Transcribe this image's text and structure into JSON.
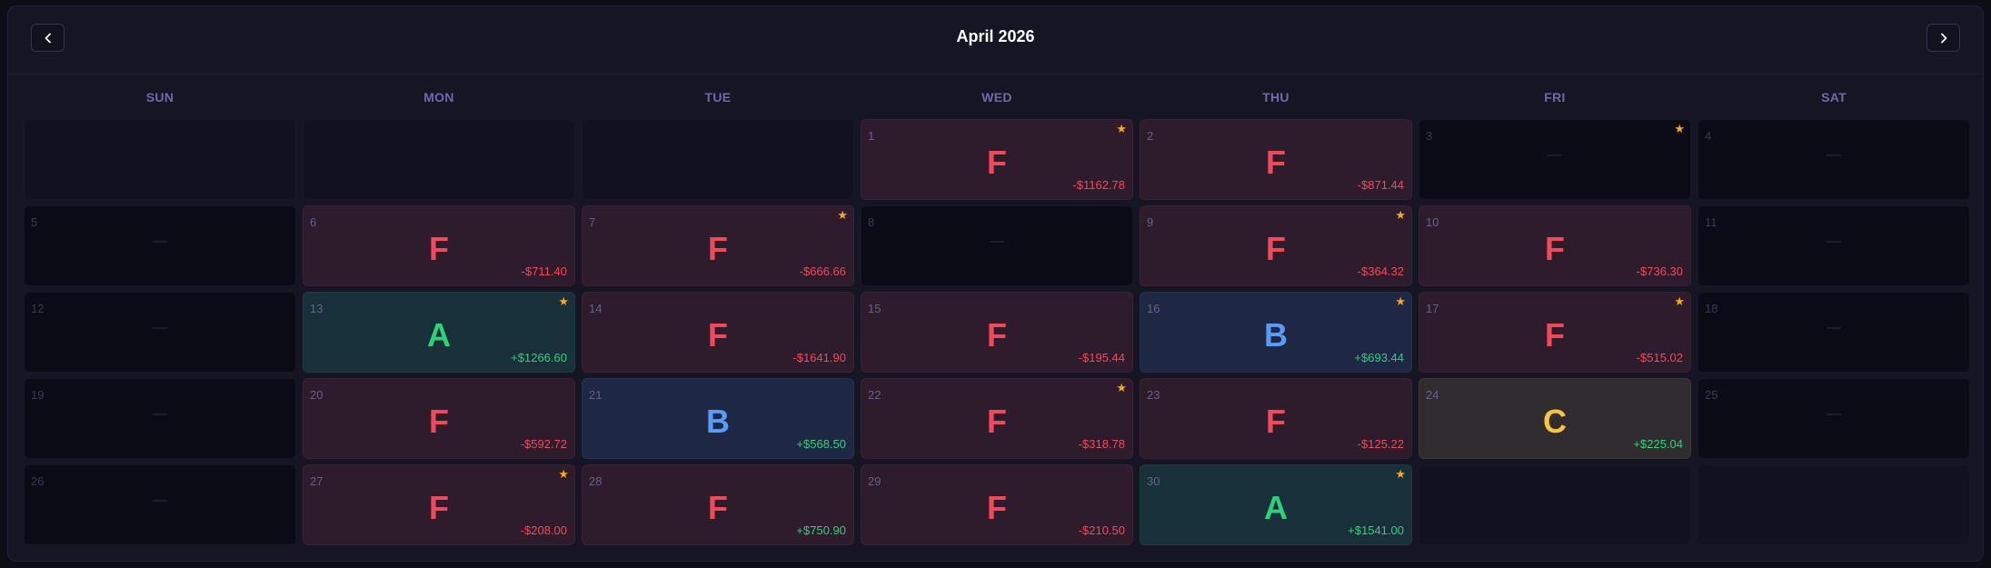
{
  "calendar": {
    "title": "April 2026",
    "prev_icon": "chevron-left-icon",
    "next_icon": "chevron-right-icon",
    "weekdays": [
      "SUN",
      "MON",
      "TUE",
      "WED",
      "THU",
      "FRI",
      "SAT"
    ],
    "empty_marker": "—",
    "star_glyph": "★",
    "cells": [
      {
        "pad": true
      },
      {
        "pad": true
      },
      {
        "pad": true
      },
      {
        "day": "1",
        "grade": "F",
        "pnl": "-$1162.78",
        "star": true
      },
      {
        "day": "2",
        "grade": "F",
        "pnl": "-$871.44",
        "star": false
      },
      {
        "day": "3",
        "grade": null,
        "pnl": null,
        "star": true
      },
      {
        "day": "4",
        "grade": null,
        "pnl": null,
        "star": false
      },
      {
        "day": "5",
        "grade": null,
        "pnl": null,
        "star": false
      },
      {
        "day": "6",
        "grade": "F",
        "pnl": "-$711.40",
        "star": false
      },
      {
        "day": "7",
        "grade": "F",
        "pnl": "-$666.66",
        "star": true
      },
      {
        "day": "8",
        "grade": null,
        "pnl": null,
        "star": false
      },
      {
        "day": "9",
        "grade": "F",
        "pnl": "-$364.32",
        "star": true
      },
      {
        "day": "10",
        "grade": "F",
        "pnl": "-$736.30",
        "star": false
      },
      {
        "day": "11",
        "grade": null,
        "pnl": null,
        "star": false
      },
      {
        "day": "12",
        "grade": null,
        "pnl": null,
        "star": false
      },
      {
        "day": "13",
        "grade": "A",
        "pnl": "+$1266.60",
        "star": true
      },
      {
        "day": "14",
        "grade": "F",
        "pnl": "-$1641.90",
        "star": false
      },
      {
        "day": "15",
        "grade": "F",
        "pnl": "-$195.44",
        "star": false
      },
      {
        "day": "16",
        "grade": "B",
        "pnl": "+$693.44",
        "star": true
      },
      {
        "day": "17",
        "grade": "F",
        "pnl": "-$515.02",
        "star": true
      },
      {
        "day": "18",
        "grade": null,
        "pnl": null,
        "star": false
      },
      {
        "day": "19",
        "grade": null,
        "pnl": null,
        "star": false
      },
      {
        "day": "20",
        "grade": "F",
        "pnl": "-$592.72",
        "star": false
      },
      {
        "day": "21",
        "grade": "B",
        "pnl": "+$568.50",
        "star": false
      },
      {
        "day": "22",
        "grade": "F",
        "pnl": "-$318.78",
        "star": true
      },
      {
        "day": "23",
        "grade": "F",
        "pnl": "-$125.22",
        "star": false
      },
      {
        "day": "24",
        "grade": "C",
        "pnl": "+$225.04",
        "star": false
      },
      {
        "day": "25",
        "grade": null,
        "pnl": null,
        "star": false
      },
      {
        "day": "26",
        "grade": null,
        "pnl": null,
        "star": false
      },
      {
        "day": "27",
        "grade": "F",
        "pnl": "-$208.00",
        "star": true
      },
      {
        "day": "28",
        "grade": "F",
        "pnl": "+$750.90",
        "star": false
      },
      {
        "day": "29",
        "grade": "F",
        "pnl": "-$210.50",
        "star": false
      },
      {
        "day": "30",
        "grade": "A",
        "pnl": "+$1541.00",
        "star": true
      },
      {
        "pad": true
      },
      {
        "pad": true
      }
    ]
  },
  "colors": {
    "grade_F": "#ef4a5a",
    "grade_A": "#2fd078",
    "grade_B": "#5a9cf5",
    "grade_C": "#f5c542",
    "star": "#f5a623",
    "weekday": "#6f68b0"
  }
}
